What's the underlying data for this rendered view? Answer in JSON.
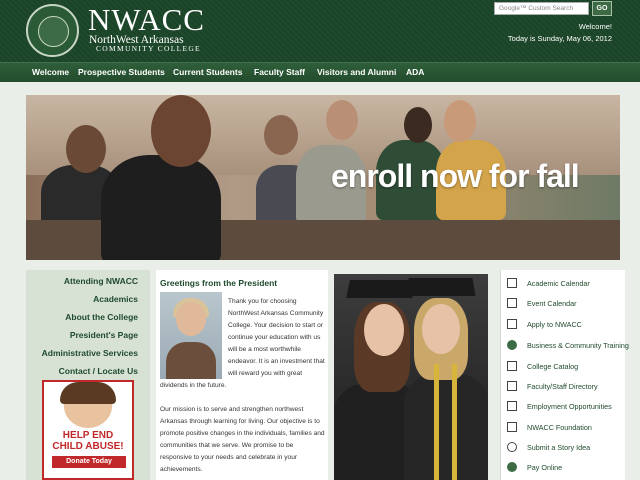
{
  "header": {
    "logo_text": "NWACC",
    "logo_sub1": "NorthWest Arkansas",
    "logo_sub2": "COMMUNITY COLLEGE",
    "search_placeholder": "Google™ Custom Search",
    "search_button": "GO",
    "welcome": "Welcome!",
    "date": "Today is Sunday, May 06, 2012"
  },
  "nav": [
    "Welcome",
    "Prospective Students",
    "Current Students",
    "Faculty Staff",
    "Visitors and Alumni",
    "ADA"
  ],
  "banner": {
    "text": "enroll now for fall"
  },
  "sidebar": {
    "links": [
      "Attending NWACC",
      "Academics",
      "About the College",
      "President's Page",
      "Administrative Services",
      "Contact / Locate Us"
    ],
    "ad": {
      "line1": "HELP END",
      "line2": "CHILD ABUSE!",
      "button": "Donate Today"
    }
  },
  "greeting": {
    "title": "Greetings from the President",
    "text1": "Thank you for choosing NorthWest Arkansas Community College. Your decision to start or continue your education with us will be a most worthwhile endeavor. It is an investment that will reward you with great",
    "text2": "dividends in the future.",
    "text3": "Our mission is to serve and strengthen northwest Arkansas through learning for living. Our objective is to promote positive changes in the individuals, families and communities that we serve. We promise to be responsive to your needs and celebrate in your achievements."
  },
  "quick_links": [
    {
      "label": "Academic Calendar",
      "icon": "calendar-icon"
    },
    {
      "label": "Event Calendar",
      "icon": "calendar-icon"
    },
    {
      "label": "Apply to NWACC",
      "icon": "checkbox-icon"
    },
    {
      "label": "Business & Community Training",
      "icon": "handshake-icon"
    },
    {
      "label": "College Catalog",
      "icon": "book-icon"
    },
    {
      "label": "Faculty/Staff Directory",
      "icon": "directory-icon"
    },
    {
      "label": "Employment Opportunities",
      "icon": "chart-icon"
    },
    {
      "label": "NWACC Foundation",
      "icon": "building-icon"
    },
    {
      "label": "Submit a Story Idea",
      "icon": "lightbulb-icon"
    },
    {
      "label": "Pay Online",
      "icon": "money-icon"
    }
  ]
}
